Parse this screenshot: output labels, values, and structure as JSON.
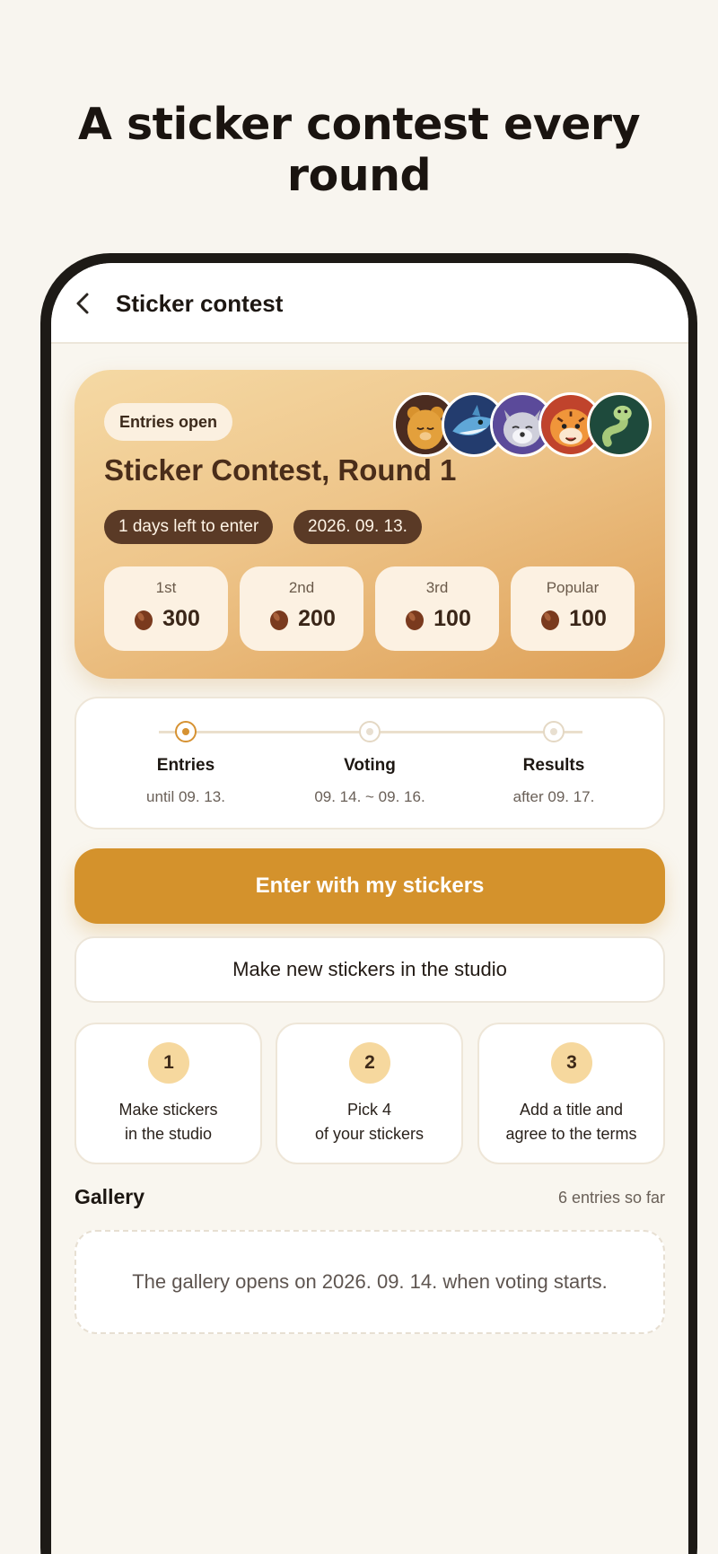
{
  "headline": "A sticker contest every round",
  "appbar": {
    "title": "Sticker contest"
  },
  "hero": {
    "badge": "Entries open",
    "title": "Sticker Contest, Round 1",
    "chips": [
      "1 days left to enter",
      "2026. 09. 13."
    ],
    "prizes": [
      {
        "label": "1st",
        "value": "300"
      },
      {
        "label": "2nd",
        "value": "200"
      },
      {
        "label": "3rd",
        "value": "100"
      },
      {
        "label": "Popular",
        "value": "100"
      }
    ],
    "avatars": [
      "bear-avatar",
      "shark-avatar",
      "raccoon-avatar",
      "tiger-avatar",
      "snake-avatar"
    ]
  },
  "timeline": {
    "steps": [
      {
        "name": "Entries",
        "date": "until 09. 13."
      },
      {
        "name": "Voting",
        "date": "09. 14. ~ 09. 16."
      },
      {
        "name": "Results",
        "date": "after 09. 17."
      }
    ],
    "active_step": 0
  },
  "actions": {
    "primary": "Enter with my stickers",
    "secondary": "Make new stickers in the studio"
  },
  "steps": [
    {
      "num": "1",
      "line1": "Make stickers",
      "line2": "in the studio"
    },
    {
      "num": "2",
      "line1": "Pick 4",
      "line2": "of your stickers"
    },
    {
      "num": "3",
      "line1": "Add a title and",
      "line2": "agree to the terms"
    }
  ],
  "gallery": {
    "title": "Gallery",
    "count": "6 entries so far",
    "notice": "The gallery opens on 2026. 09. 14. when voting starts."
  },
  "colors": {
    "accent": "#d4922c",
    "chip": "#5a3a26",
    "background": "#f8f5ef"
  }
}
